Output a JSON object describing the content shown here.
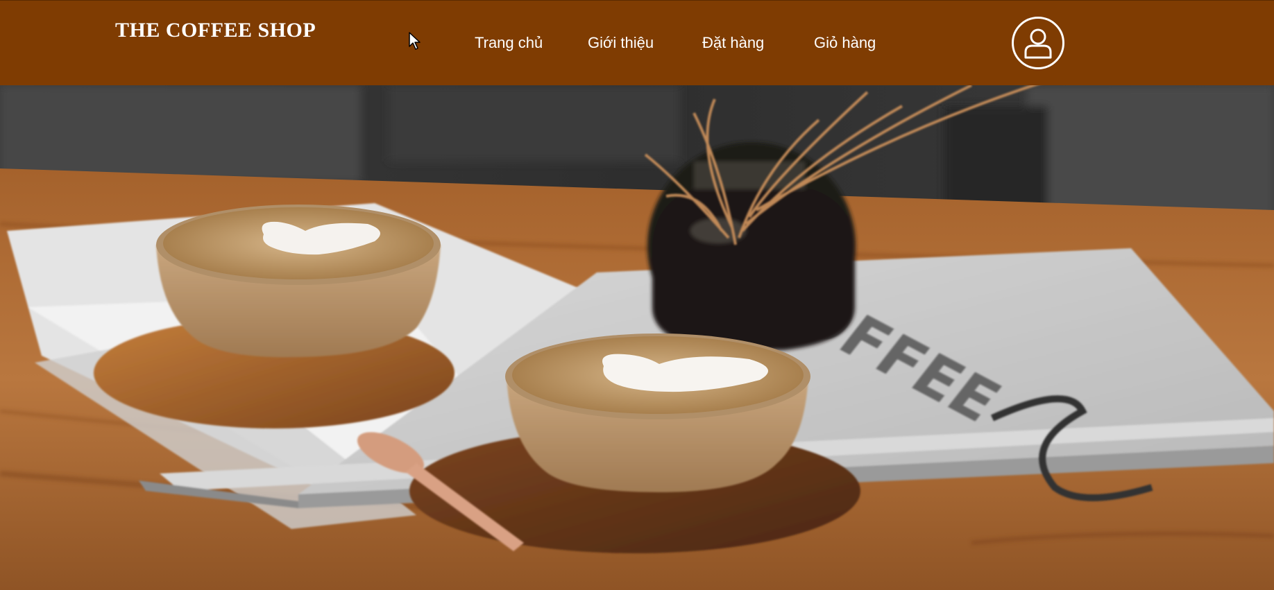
{
  "brand": {
    "name": "THE COFFEE SHOP"
  },
  "nav": {
    "items": [
      {
        "label": "Trang chủ"
      },
      {
        "label": "Giới thiệu"
      },
      {
        "label": "Đặt hàng"
      },
      {
        "label": "Giỏ hàng"
      }
    ]
  },
  "user": {
    "icon": "user-icon"
  },
  "hero": {
    "magazine_text": "COFFEE"
  },
  "colors": {
    "navbar": "#7f3c02",
    "text": "#ffffff"
  }
}
